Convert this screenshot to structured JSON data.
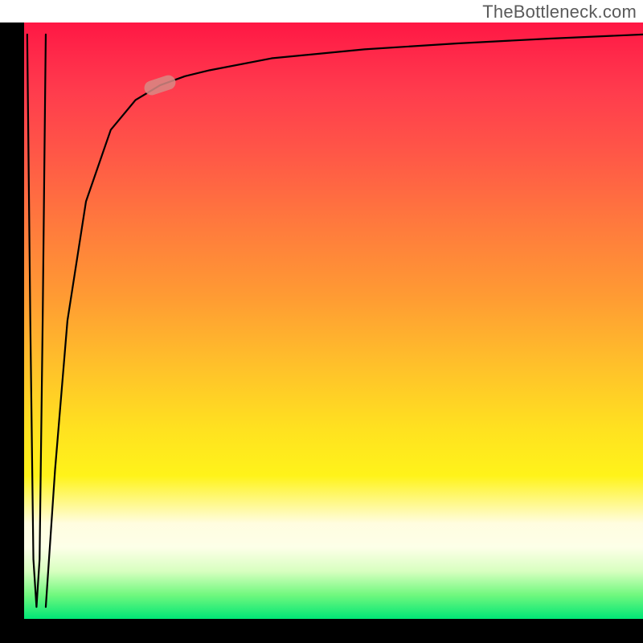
{
  "watermark": "TheBottleneck.com",
  "colors": {
    "frame": "#000000",
    "curve": "#000000",
    "marker": "#d88a85",
    "gradient_top": "#ff1744",
    "gradient_mid": "#fff31a",
    "gradient_bottom": "#00e676"
  },
  "chart_data": {
    "type": "line",
    "title": "",
    "xlabel": "",
    "ylabel": "",
    "xlim": [
      0,
      100
    ],
    "ylim": [
      0,
      100
    ],
    "grid": false,
    "legend": false,
    "series": [
      {
        "name": "spike",
        "x": [
          0.5,
          1.0,
          1.5,
          2.0,
          2.5,
          3.0,
          3.5
        ],
        "values": [
          98,
          50,
          10,
          2,
          10,
          50,
          98
        ]
      },
      {
        "name": "curve",
        "x": [
          3.5,
          5,
          7,
          10,
          14,
          18,
          22,
          26,
          30,
          40,
          55,
          70,
          85,
          100
        ],
        "values": [
          2,
          25,
          50,
          70,
          82,
          87,
          89.5,
          91,
          92,
          94,
          95.5,
          96.5,
          97.3,
          98
        ]
      }
    ],
    "annotations": [
      {
        "name": "marker",
        "x": 22,
        "y": 89.5,
        "shape": "pill",
        "angle_deg": -18
      }
    ],
    "background": "vertical-gradient red→yellow→green"
  }
}
